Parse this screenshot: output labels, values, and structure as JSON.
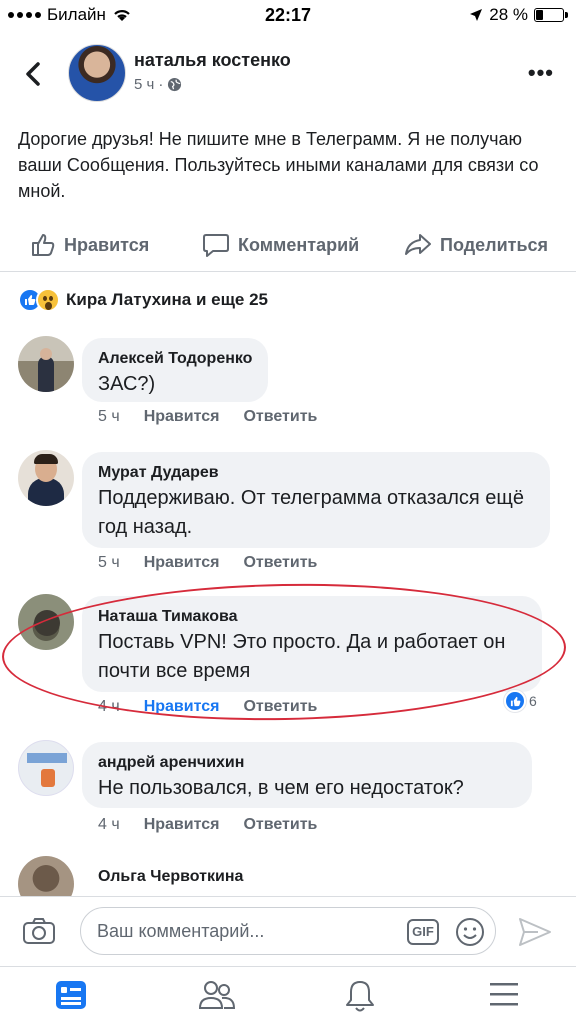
{
  "status_bar": {
    "carrier": "Билайн",
    "time": "22:17",
    "battery": "28 %",
    "battery_level": 0.28
  },
  "post": {
    "author": "наталья костенко",
    "time": "5 ч",
    "text": "Дорогие друзья! Не пишите мне в Телеграмм. Я не получаю ваши Сообщения. Пользуйтесь иными каналами для связи со мной.",
    "actions": {
      "like": "Нравится",
      "comment": "Комментарий",
      "share": "Поделиться"
    },
    "reactions_summary": "Кира Латухина и еще 25"
  },
  "comments": [
    {
      "name": "Алексей Тодоренко",
      "text": "ЗАС?)",
      "time": "5 ч",
      "like": "Нравится",
      "reply": "Ответить"
    },
    {
      "name": "Мурат Дударев",
      "text": "Поддерживаю. От телеграмма отказался ещё год назад.",
      "time": "5 ч",
      "like": "Нравится",
      "reply": "Ответить"
    },
    {
      "name": "Наташа Тимакова",
      "text": "Поставь VPN! Это просто. Да и работает он почти все время",
      "time": "4 ч",
      "like": "Нравится",
      "reply": "Ответить",
      "likes": "6"
    },
    {
      "name": "андрей аренчихин",
      "text": "Не пользовался, в чем его недостаток?",
      "time": "4 ч",
      "like": "Нравится",
      "reply": "Ответить"
    },
    {
      "name": "Ольга Червоткина"
    }
  ],
  "composer": {
    "placeholder": "Ваш комментарий...",
    "gif_label": "GIF"
  },
  "colors": {
    "accent": "#1877f2",
    "highlight_oval": "#d62b3b",
    "bubble": "#f0f2f5"
  },
  "icons": [
    "back-icon",
    "globe-icon",
    "more-icon",
    "like-icon",
    "comment-icon",
    "share-icon",
    "camera-icon",
    "gif-icon",
    "smile-icon",
    "send-icon",
    "news-feed-icon",
    "friends-icon",
    "notifications-icon",
    "menu-icon"
  ]
}
